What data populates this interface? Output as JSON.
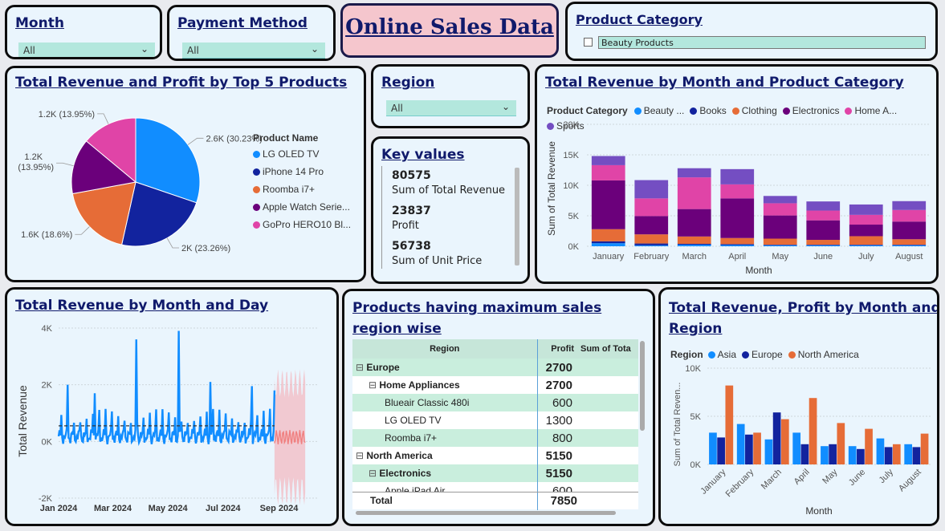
{
  "title": "Online Sales Data",
  "slicers": {
    "month": {
      "label": "Month",
      "value": "All"
    },
    "payment": {
      "label": "Payment Method",
      "value": "All"
    },
    "region": {
      "label": "Region",
      "value": "All"
    },
    "category": {
      "label": "Product Category",
      "item": "Beauty Products"
    }
  },
  "key_values": {
    "title": "Key values",
    "items": [
      {
        "value": "80575",
        "label": "Sum of Total Revenue"
      },
      {
        "value": "23837",
        "label": "Profit"
      },
      {
        "value": "56738",
        "label": "Sum of Unit Price"
      }
    ]
  },
  "pie": {
    "title": "Total Revenue and Profit by Top 5 Products",
    "legend_title": "Product Name",
    "colors": [
      "#118DFF",
      "#12239E",
      "#E66C37",
      "#6B007B",
      "#E044A7"
    ],
    "chart_data": {
      "type": "pie",
      "categories": [
        "LG OLED TV",
        "iPhone 14 Pro",
        "Roomba i7+",
        "Apple Watch Series 8",
        "GoPro HERO10 Black"
      ],
      "legend_labels": [
        "LG OLED TV",
        "iPhone 14 Pro",
        "Roomba i7+",
        "Apple Watch Serie...",
        "GoPro HERO10 Bl..."
      ],
      "values": [
        2600,
        2000,
        1600,
        1200,
        1200
      ],
      "percents": [
        30.23,
        23.26,
        18.6,
        13.95,
        13.95
      ],
      "data_labels": [
        "2.6K (30.23%)",
        "2K (23.26%)",
        "1.6K (18.6%)",
        "1.2K (13.95%)",
        "1.2K (13.95%)"
      ]
    }
  },
  "stacked": {
    "title": "Total Revenue by Month and Product Category",
    "legend_title": "Product Category",
    "chart_data": {
      "type": "bar",
      "stacked": true,
      "categories": [
        "January",
        "February",
        "March",
        "April",
        "May",
        "June",
        "July",
        "August"
      ],
      "series": [
        {
          "name": "Beauty ...",
          "color": "#118DFF",
          "values": [
            500,
            150,
            250,
            200,
            150,
            150,
            150,
            150
          ]
        },
        {
          "name": "Books",
          "color": "#12239E",
          "values": [
            300,
            300,
            150,
            150,
            100,
            100,
            100,
            100
          ]
        },
        {
          "name": "Clothing",
          "color": "#E66C37",
          "values": [
            2000,
            1500,
            1200,
            1000,
            1000,
            800,
            1400,
            900
          ]
        },
        {
          "name": "Electronics",
          "color": "#6B007B",
          "values": [
            8000,
            3000,
            4500,
            6500,
            3800,
            3200,
            1900,
            2900
          ]
        },
        {
          "name": "Home A...",
          "color": "#E044A7",
          "values": [
            2500,
            2900,
            5200,
            2300,
            2000,
            1600,
            1600,
            1900
          ]
        },
        {
          "name": "Sports",
          "color": "#744EC2",
          "values": [
            1500,
            3000,
            1500,
            2500,
            1200,
            1500,
            1700,
            1450
          ]
        }
      ],
      "ylabel": "Sum of Total Revenue",
      "xlabel": "Month",
      "ylim": [
        0,
        20000
      ],
      "yticks": [
        "0K",
        "5K",
        "10K",
        "15K",
        "20K"
      ]
    }
  },
  "line": {
    "title": "Total Revenue by Month and Day",
    "chart_data": {
      "type": "line",
      "ylabel": "Total Revenue",
      "ylim": [
        -2000,
        4000
      ],
      "yticks": [
        "-2K",
        "0K",
        "2K",
        "4K"
      ],
      "xticks": [
        "Jan 2024",
        "Mar 2024",
        "May 2024",
        "Jul 2024",
        "Sep 2024"
      ],
      "x_start": "2024-01-01",
      "x_end": "2024-10-15",
      "trend_value": 550,
      "forecast_range": [
        "2024-08-27",
        "2024-09-30"
      ],
      "spikes": [
        [
          10,
          2000
        ],
        [
          40,
          1700
        ],
        [
          86,
          3600
        ],
        [
          133,
          3900
        ],
        [
          168,
          2100
        ],
        [
          214,
          1950
        ],
        [
          239,
          1800
        ]
      ],
      "series": [
        {
          "name": "Total Revenue",
          "color": "#118DFF"
        },
        {
          "name": "Forecast",
          "color": "#F08080"
        }
      ]
    }
  },
  "matrix": {
    "title": "Products having maximum sales region wise",
    "headers": [
      "Region",
      "Profit",
      "Sum of Tota"
    ],
    "rows": [
      {
        "label": "Europe",
        "level": 0,
        "expander": "⊟",
        "value": "2700"
      },
      {
        "label": "Home Appliances",
        "level": 1,
        "expander": "⊟",
        "value": "2700"
      },
      {
        "label": "Blueair Classic 480i",
        "level": 2,
        "expander": "",
        "value": "600"
      },
      {
        "label": "LG OLED TV",
        "level": 2,
        "expander": "",
        "value": "1300"
      },
      {
        "label": "Roomba i7+",
        "level": 2,
        "expander": "",
        "value": "800"
      },
      {
        "label": "North America",
        "level": 0,
        "expander": "⊟",
        "value": "5150"
      },
      {
        "label": "Electronics",
        "level": 1,
        "expander": "⊟",
        "value": "5150"
      },
      {
        "label": "Apple iPad Air",
        "level": 2,
        "expander": "",
        "value": "600"
      }
    ],
    "total": {
      "label": "Total",
      "value": "7850"
    }
  },
  "cluster": {
    "title_line1": "Total Revenue, Profit by Month and",
    "title_line2": "Region",
    "legend_title": "Region",
    "chart_data": {
      "type": "bar",
      "categories": [
        "January",
        "February",
        "March",
        "April",
        "May",
        "June",
        "July",
        "August"
      ],
      "series": [
        {
          "name": "Asia",
          "color": "#118DFF",
          "values": [
            3300,
            4200,
            2600,
            3300,
            1900,
            1900,
            2700,
            2100
          ]
        },
        {
          "name": "Europe",
          "color": "#12239E",
          "values": [
            2800,
            3100,
            5400,
            2100,
            2100,
            1600,
            1800,
            1800
          ]
        },
        {
          "name": "North America",
          "color": "#E66C37",
          "values": [
            8200,
            3300,
            4700,
            6900,
            4300,
            3700,
            2100,
            3200
          ]
        }
      ],
      "ylabel": "Sum of Total Reven...",
      "xlabel": "Month",
      "ylim": [
        0,
        10000
      ],
      "yticks": [
        "0K",
        "5K",
        "10K"
      ]
    }
  }
}
